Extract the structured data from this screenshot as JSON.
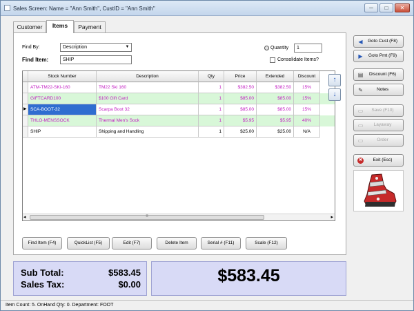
{
  "window": {
    "title": "Sales Screen: Name = \"Ann Smith\", CustID = \"Ann Smith\"",
    "minimize": "─",
    "maximize": "□",
    "close": "✕"
  },
  "tabs": [
    {
      "label": "Customer"
    },
    {
      "label": "Items"
    },
    {
      "label": "Payment"
    }
  ],
  "form": {
    "find_by_label": "Find By:",
    "find_by_value": "Description",
    "find_item_label": "Find Item:",
    "find_item_value": "SHIP",
    "quantity_label": "Quantity",
    "quantity_value": "1",
    "consolidate_label": "Consolidate Items?"
  },
  "grid": {
    "columns": [
      "Stock Number",
      "Description",
      "Qty",
      "Price",
      "Extended",
      "Discount"
    ],
    "rows": [
      {
        "stock": "ATM-TM22-SKI-160",
        "desc": "TM22 Ski 160",
        "qty": "1",
        "price": "$382.50",
        "ext": "$382.50",
        "disc": "15%"
      },
      {
        "stock": "GIFTCARD100",
        "desc": "$100 Gift Card",
        "qty": "1",
        "price": "$85.00",
        "ext": "$85.00",
        "disc": "15%"
      },
      {
        "stock": "SCA-BOOT-32",
        "desc": "Scarpa Boot 32",
        "qty": "1",
        "price": "$85.00",
        "ext": "$85.00",
        "disc": "15%"
      },
      {
        "stock": "THLO-MENSSOCK",
        "desc": "Thermal Men's Sock",
        "qty": "1",
        "price": "$5.95",
        "ext": "$5.95",
        "disc": "40%"
      },
      {
        "stock": "SHIP",
        "desc": "Shipping and Handling",
        "qty": "1",
        "price": "$25.00",
        "ext": "$25.00",
        "disc": "N/A"
      }
    ],
    "row_indicator": "▶",
    "scroll_left": "◂",
    "scroll_right": "▸",
    "scroll_grip": "≡"
  },
  "row_buttons": {
    "up": "↑",
    "down": "↓"
  },
  "bottom_buttons": [
    {
      "label": "Find Item (F4)"
    },
    {
      "label": "QuickList (F5)"
    },
    {
      "label": "Edit (F7)"
    },
    {
      "label": "Delete Item"
    },
    {
      "label": "Serial # (F11)"
    },
    {
      "label": "Scale (F12)"
    }
  ],
  "side_buttons": [
    {
      "label": "Goto Cust (F8)",
      "icon": "◀"
    },
    {
      "label": "Goto Pmt (F9)",
      "icon": "▶"
    },
    {
      "label": "Discount (F6)",
      "icon": "▤"
    },
    {
      "label": "Notes",
      "icon": "✎"
    },
    {
      "label": "Save (F10)",
      "icon": "▭"
    },
    {
      "label": "Layaway",
      "icon": "▭"
    },
    {
      "label": "Order",
      "icon": "▭"
    },
    {
      "label": "Exit (Esc)",
      "icon": "✖"
    }
  ],
  "totals": {
    "subtotal_label": "Sub Total:",
    "subtotal_value": "$583.45",
    "tax_label": "Sales Tax:",
    "tax_value": "$0.00",
    "grand_total": "$583.45"
  },
  "status": {
    "text": "Item Count: 5.  OnHand Qty: 0.  Department: FOOT"
  },
  "colors": {
    "magenta_text": "#c21bc2",
    "green_row": "#d8f7d8",
    "selection": "#2f6dd0",
    "totals_bg": "#d8daf6"
  }
}
